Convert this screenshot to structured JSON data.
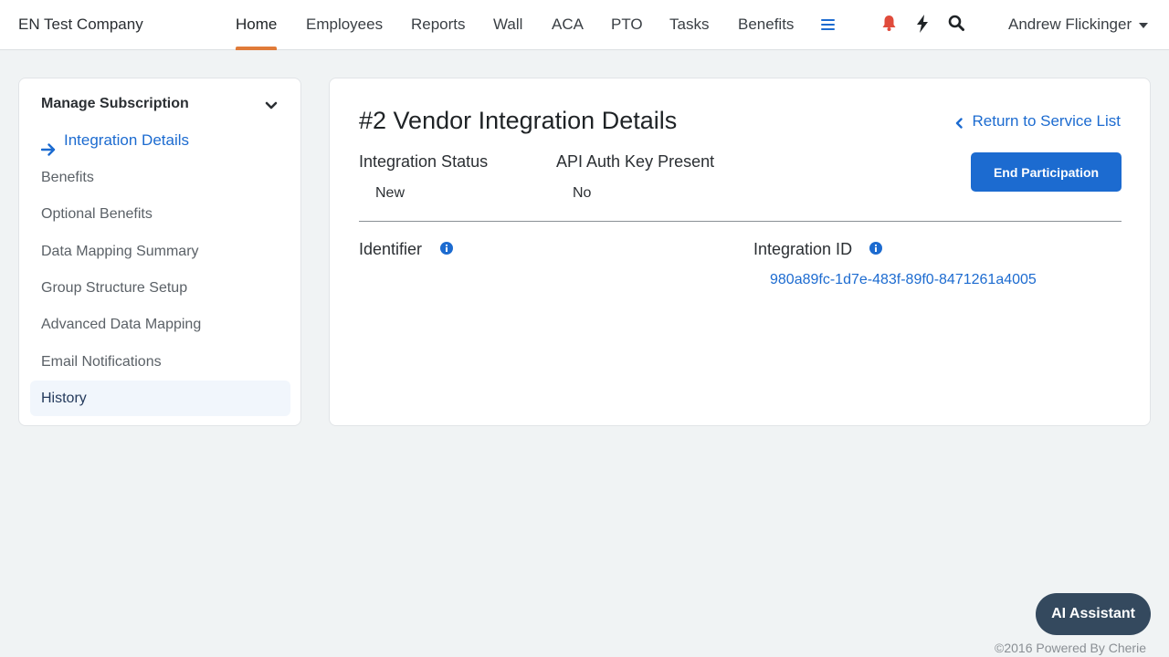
{
  "header": {
    "company": "EN Test Company",
    "nav": [
      "Home",
      "Employees",
      "Reports",
      "Wall",
      "ACA",
      "PTO",
      "Tasks",
      "Benefits"
    ],
    "active_nav": "Home",
    "user": "Andrew Flickinger"
  },
  "sidebar": {
    "heading": "Manage Subscription",
    "items": [
      {
        "label": "Integration Details"
      },
      {
        "label": "Benefits"
      },
      {
        "label": "Optional Benefits"
      },
      {
        "label": "Data Mapping Summary"
      },
      {
        "label": "Group Structure Setup"
      },
      {
        "label": "Advanced Data Mapping"
      },
      {
        "label": "Email Notifications"
      },
      {
        "label": "History"
      }
    ]
  },
  "main": {
    "title": "#2 Vendor Integration Details",
    "return_link": "Return to Service List",
    "end_button": "End Participation",
    "integration_status_label": "Integration Status",
    "integration_status_value": "New",
    "api_key_label": "API Auth Key Present",
    "api_key_value": "No",
    "identifier_label": "Identifier",
    "integration_id_label": "Integration ID",
    "integration_id_value": "980a89fc-1d7e-483f-89f0-8471261a4005"
  },
  "footer": {
    "ai_assistant": "AI Assistant",
    "copyright": "©2016 Powered By Cherie"
  },
  "colors": {
    "accent": "#1c6bd0",
    "nav_underline": "#e07b39",
    "notification": "#e04b3b",
    "ai_button": "#34495e",
    "page_bg": "#f0f3f4"
  }
}
